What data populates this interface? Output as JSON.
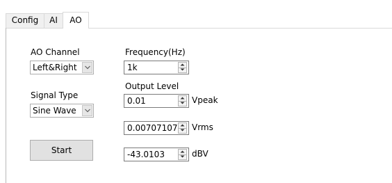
{
  "tabs": [
    {
      "label": "Config"
    },
    {
      "label": "AI"
    },
    {
      "label": "AO",
      "active": true
    }
  ],
  "ao_channel": {
    "label": "AO Channel",
    "value": "Left&Right"
  },
  "signal_type": {
    "label": "Signal Type",
    "value": "Sine Wave"
  },
  "start_button": {
    "label": "Start"
  },
  "frequency": {
    "label": "Frequency(Hz)",
    "value": "1k"
  },
  "output_level": {
    "label": "Output Level",
    "vpeak": {
      "value": "0.01",
      "unit": "Vpeak"
    },
    "vrms": {
      "value": "0.00707107",
      "unit": "Vrms"
    },
    "dbv": {
      "value": "-43.0103",
      "unit": "dBV"
    }
  },
  "icons": {
    "combo_arrow": "chevron-down-icon",
    "spin_up": "triangle-up-icon",
    "spin_down": "triangle-down-icon"
  }
}
